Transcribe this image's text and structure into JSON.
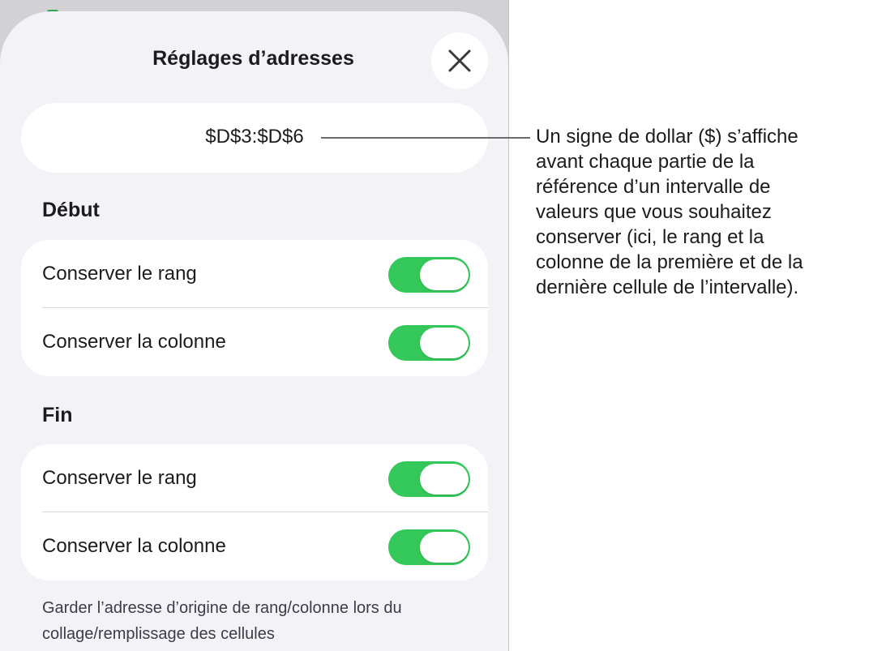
{
  "sheet": {
    "title": "Réglages d’adresses",
    "close_icon": "close-icon",
    "address": "$D$3:$D$6"
  },
  "sections": {
    "start": {
      "header": "Début",
      "rows": [
        {
          "label": "Conserver le rang",
          "on": true
        },
        {
          "label": "Conserver la colonne",
          "on": true
        }
      ]
    },
    "end": {
      "header": "Fin",
      "rows": [
        {
          "label": "Conserver le rang",
          "on": true
        },
        {
          "label": "Conserver la colonne",
          "on": true
        }
      ]
    }
  },
  "footer_note": "Garder l’adresse d’origine de rang/colonne lors du collage/remplissage des cellules",
  "callout": "Un signe de dollar ($) s’affiche\navant chaque partie de la\nréférence d’un intervalle de\nvaleurs que vous souhaitez\nconserver (ici, le rang et la\ncolonne de la première et de la\ndernière cellule de l’intervalle).",
  "colors": {
    "toggle_on": "#34c759",
    "sheet_background": "#f2f2f7",
    "card_background": "#ffffff"
  }
}
